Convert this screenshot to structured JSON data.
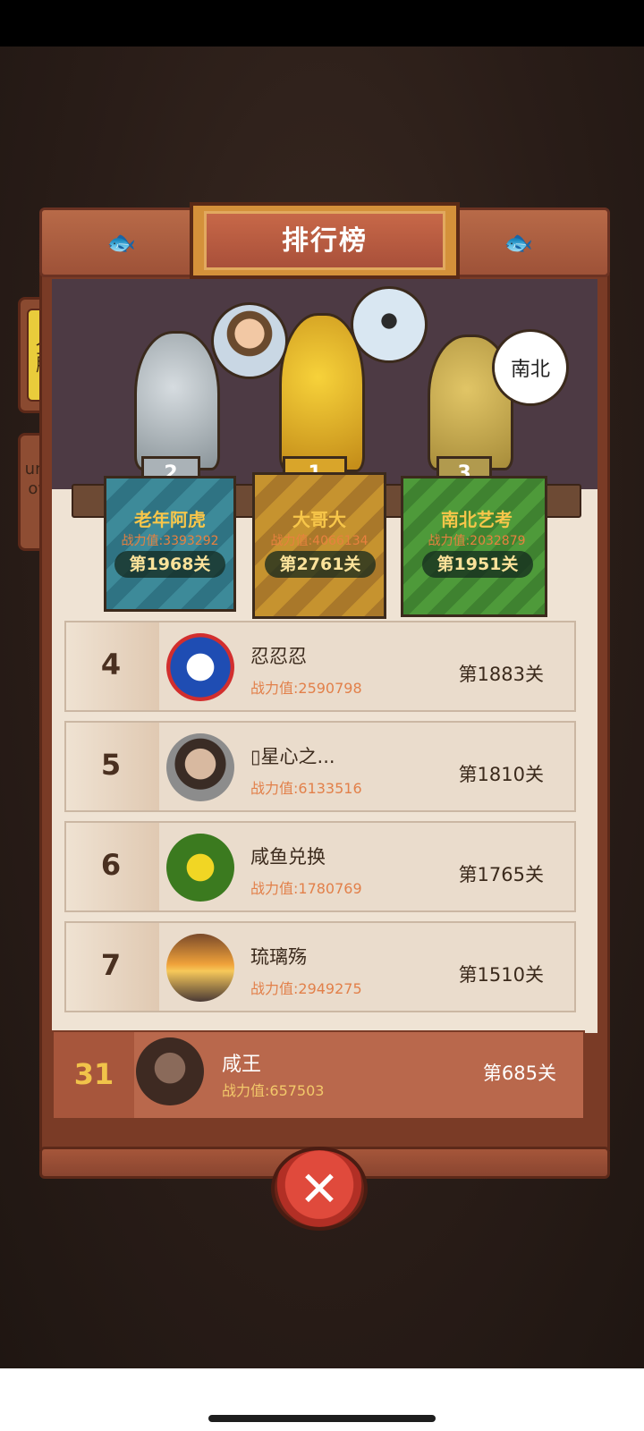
{
  "title": "排行榜",
  "tabs": {
    "all": "全服",
    "unknown": "unknown"
  },
  "podium": [
    {
      "rank": "2",
      "name": "老年阿虎",
      "power": "战力值:3393292",
      "level": "第1968关"
    },
    {
      "rank": "1",
      "name": "大哥大",
      "power": "战力值:4066134",
      "level": "第2761关"
    },
    {
      "rank": "3",
      "name": "南北艺考",
      "power": "战力值:2032879",
      "level": "第1951关"
    }
  ],
  "avatar3_text": "南北",
  "rows": [
    {
      "rank": "4",
      "name": "忍忍忍",
      "power": "战力值:2590798",
      "level": "第1883关",
      "avatar": "pepsi-avatar"
    },
    {
      "rank": "5",
      "name": "▯星心之...",
      "power": "战力值:6133516",
      "level": "第1810关",
      "avatar": "man-avatar"
    },
    {
      "rank": "6",
      "name": "咸鱼兑换",
      "power": "战力值:1780769",
      "level": "第1765关",
      "avatar": "flower-avatar"
    },
    {
      "rank": "7",
      "name": "琉璃殇",
      "power": "战力值:2949275",
      "level": "第1510关",
      "avatar": "sunset-avatar"
    }
  ],
  "me": {
    "rank": "31",
    "name": "咸王",
    "power": "战力值:657503",
    "level": "第685关"
  },
  "close_icon": "✕",
  "colors": {
    "accent": "#f7c64a",
    "power": "#e2804a",
    "board": "#7a3b26"
  }
}
